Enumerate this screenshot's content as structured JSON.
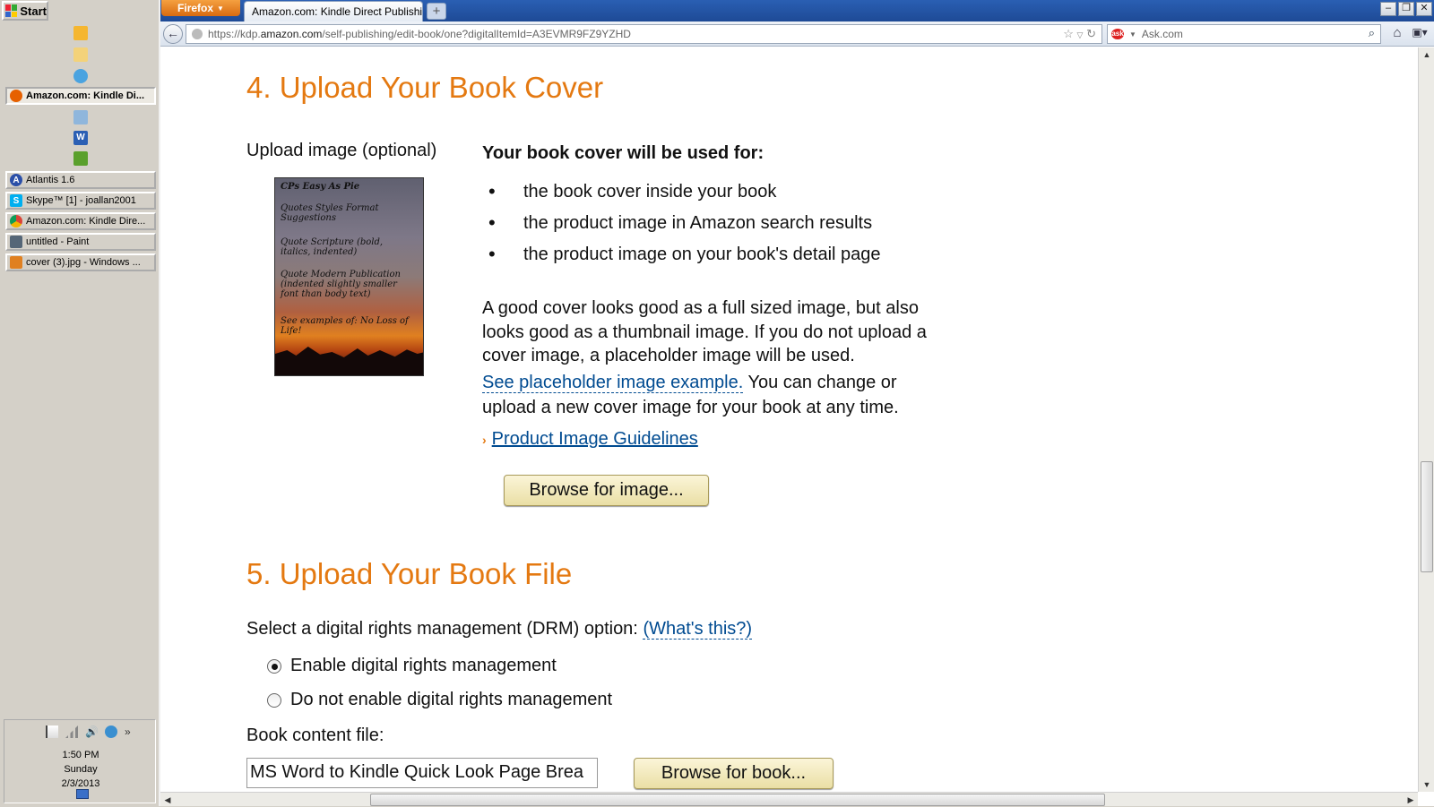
{
  "taskbar": {
    "start_label": "Start",
    "tasks": [
      {
        "label": "Amazon.com: Kindle Di...",
        "icon": "firefox-icon",
        "color": "#e66000"
      },
      {
        "label": "Atlantis 1.6",
        "icon": "atlantis-icon",
        "color": "#2b4fa8"
      },
      {
        "label": "Skype™ [1] - joallan2001",
        "icon": "skype-icon",
        "color": "#00aff0"
      },
      {
        "label": "Amazon.com: Kindle Dire...",
        "icon": "chrome-icon",
        "color": "#3a8f3a"
      },
      {
        "label": "untitled - Paint",
        "icon": "paint-icon",
        "color": "#556677"
      },
      {
        "label": "cover (3).jpg - Windows ...",
        "icon": "photo-viewer-icon",
        "color": "#e08020"
      }
    ],
    "clock": {
      "time": "1:50 PM",
      "day": "Sunday",
      "date": "2/3/2013"
    }
  },
  "browser": {
    "firefox_label": "Firefox",
    "tab_title": "Amazon.com: Kindle Direct Publishi...",
    "new_tab_label": "+",
    "url_prefix": "https://kdp.",
    "url_host": "amazon.com",
    "url_path": "/self-publishing/edit-book/one?digitalItemId=A3EVMR9FZ9YZHD",
    "search_placeholder": "Ask.com"
  },
  "section4": {
    "title": "4. Upload Your Book Cover",
    "upload_label": "Upload image (optional)",
    "cover_lines": [
      "CPs Easy As Pie",
      "Quotes Styles Format Suggestions",
      "Quote Scripture (bold, italics, indented)",
      "Quote Modern Publication (indented slightly smaller font than body text)",
      "See examples of: No Loss of Life!"
    ],
    "used_for_heading": "Your book cover will be used for:",
    "used_for_items": [
      "the book cover inside your book",
      "the product image in Amazon search results",
      "the product image on your book's detail page"
    ],
    "paragraph_line1": "A good cover looks good as a full sized image, but also",
    "paragraph_line2": "looks good as a thumbnail image. If you do not upload a",
    "paragraph_line3": "cover image, a placeholder image will be used.",
    "placeholder_link": "See placeholder image example.",
    "paragraph_tail1": " You can change or",
    "paragraph_line5": "upload a new cover image for your book at any time.",
    "guidelines_link": "Product Image Guidelines",
    "browse_image_button": "Browse for image..."
  },
  "section5": {
    "title": "5. Upload Your Book File",
    "drm_prompt": "Select a digital rights management (DRM) option:",
    "whats_this_link": "(What's this?)",
    "drm_options": [
      {
        "label": "Enable digital rights management",
        "checked": true
      },
      {
        "label": "Do not enable digital rights management",
        "checked": false
      }
    ],
    "content_file_label": "Book content file:",
    "content_file_value": "MS Word to Kindle Quick Look Page Brea",
    "browse_book_button": "Browse for book..."
  },
  "colors": {
    "accent_orange": "#e47911",
    "link_blue": "#004b91"
  }
}
